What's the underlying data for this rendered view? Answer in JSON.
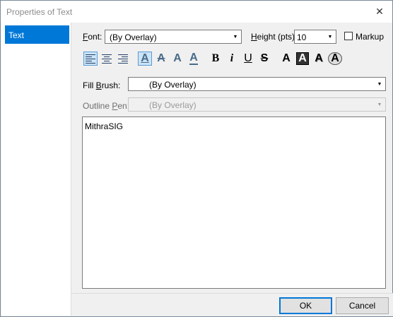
{
  "window": {
    "title": "Properties of Text",
    "close_glyph": "✕"
  },
  "sidebar": {
    "items": [
      {
        "label": "Text",
        "selected": true
      }
    ]
  },
  "font": {
    "label_prefix": "",
    "label_accel": "F",
    "label_rest": "ont:",
    "value": "(By Overlay)"
  },
  "height": {
    "label_accel": "H",
    "label_rest": "eight (pts):",
    "value": "10"
  },
  "markup": {
    "label": "Markup",
    "checked": false
  },
  "toolbar": {
    "bold": "B",
    "italic": "i",
    "underline": "U",
    "strike": "S",
    "style_plain": "A",
    "style_outline": "A",
    "style_shadow": "A",
    "style_emboss": "A",
    "effect_plain": "A",
    "effect_strike": "A",
    "effect_raised": "A",
    "effect_under": "A"
  },
  "fill_brush": {
    "label_pre": "Fill ",
    "label_accel": "B",
    "label_rest": "rush:",
    "value": "(By Overlay)"
  },
  "outline_pen": {
    "label_pre": "Outline ",
    "label_accel": "P",
    "label_rest": "en:",
    "value": "(By Overlay)",
    "enabled": false
  },
  "text_content": "MithraSIG",
  "buttons": {
    "ok": "OK",
    "cancel": "Cancel"
  },
  "colors": {
    "accent": "#0078d7",
    "active_tool": "#cce4f7"
  },
  "icons": [
    "close-icon",
    "dropdown-arrow-icon",
    "align-left-icon",
    "align-center-icon",
    "align-right-icon"
  ]
}
